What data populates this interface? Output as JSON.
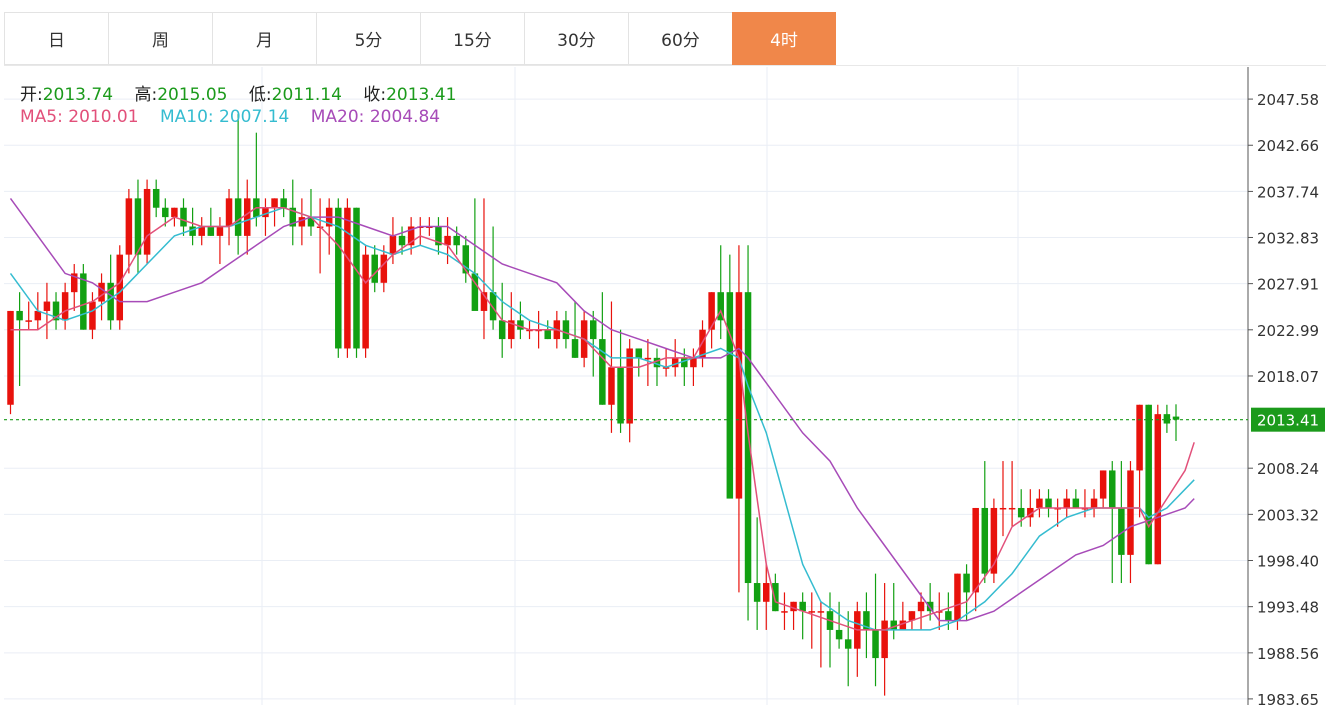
{
  "tabs": [
    {
      "label": "日",
      "active": false
    },
    {
      "label": "周",
      "active": false
    },
    {
      "label": "月",
      "active": false
    },
    {
      "label": "5分",
      "active": false
    },
    {
      "label": "15分",
      "active": false
    },
    {
      "label": "30分",
      "active": false
    },
    {
      "label": "60分",
      "active": false
    },
    {
      "label": "4时",
      "active": true
    }
  ],
  "ohlc": {
    "open_label": "开:",
    "open": "2013.74",
    "high_label": "高:",
    "high": "2015.05",
    "low_label": "低:",
    "low": "2011.14",
    "close_label": "收:",
    "close": "2013.41"
  },
  "ma": {
    "ma5_label": "MA5:",
    "ma5": "2010.01",
    "ma10_label": "MA10:",
    "ma10": "2007.14",
    "ma20_label": "MA20:",
    "ma20": "2004.84"
  },
  "colors": {
    "up": "#e8120c",
    "down": "#12a012",
    "ma5": "#e2507a",
    "ma10": "#35bcd0",
    "ma20": "#a74bb8",
    "current": "#1b9a1b",
    "accent": "#f0874a"
  },
  "chart_data": {
    "type": "candlestick",
    "ylim": [
      1983.0,
      2051.0
    ],
    "yticks": [
      "2047.58",
      "2042.66",
      "2037.74",
      "2032.83",
      "2027.91",
      "2022.99",
      "2018.07",
      "2013.41",
      "2008.24",
      "2003.32",
      "1998.40",
      "1993.48",
      "1988.56",
      "1983.65"
    ],
    "current_price": "2013.41",
    "candles": [
      [
        2015,
        2025,
        2014,
        2025
      ],
      [
        2025,
        2027,
        2017,
        2024
      ],
      [
        2024,
        2026,
        2023,
        2024
      ],
      [
        2024,
        2027,
        2023,
        2025
      ],
      [
        2025,
        2028,
        2022,
        2026
      ],
      [
        2026,
        2027,
        2023,
        2024
      ],
      [
        2024,
        2028,
        2023,
        2027
      ],
      [
        2027,
        2030,
        2025,
        2029
      ],
      [
        2029,
        2030,
        2023,
        2023
      ],
      [
        2023,
        2027,
        2022,
        2026
      ],
      [
        2026,
        2029,
        2024,
        2028
      ],
      [
        2028,
        2031,
        2023,
        2024
      ],
      [
        2024,
        2032,
        2023,
        2031
      ],
      [
        2031,
        2038,
        2029,
        2037
      ],
      [
        2037,
        2039,
        2029,
        2031
      ],
      [
        2031,
        2039,
        2030,
        2038
      ],
      [
        2038,
        2039,
        2035,
        2036
      ],
      [
        2036,
        2037,
        2034,
        2035
      ],
      [
        2035,
        2036,
        2034,
        2036
      ],
      [
        2036,
        2037,
        2033,
        2034
      ],
      [
        2034,
        2036,
        2032,
        2033
      ],
      [
        2033,
        2035,
        2032,
        2034
      ],
      [
        2034,
        2036,
        2033,
        2033
      ],
      [
        2033,
        2035,
        2030,
        2034
      ],
      [
        2034,
        2038,
        2032,
        2037
      ],
      [
        2037,
        2046,
        2031,
        2033
      ],
      [
        2033,
        2039,
        2031,
        2037
      ],
      [
        2037,
        2044,
        2034,
        2035
      ],
      [
        2035,
        2037,
        2033,
        2036
      ],
      [
        2036,
        2037,
        2034,
        2037
      ],
      [
        2037,
        2038,
        2035,
        2036
      ],
      [
        2036,
        2039,
        2032,
        2034
      ],
      [
        2034,
        2037,
        2032,
        2035
      ],
      [
        2035,
        2038,
        2033,
        2034
      ],
      [
        2034,
        2037,
        2029,
        2034
      ],
      [
        2034,
        2037,
        2031,
        2036
      ],
      [
        2036,
        2037,
        2020,
        2021
      ],
      [
        2021,
        2037,
        2020,
        2036
      ],
      [
        2036,
        2036,
        2020,
        2021
      ],
      [
        2021,
        2032,
        2020,
        2031
      ],
      [
        2031,
        2032,
        2027,
        2028
      ],
      [
        2028,
        2032,
        2027,
        2031
      ],
      [
        2031,
        2035,
        2030,
        2033
      ],
      [
        2033,
        2034,
        2031,
        2032
      ],
      [
        2032,
        2035,
        2031,
        2034
      ],
      [
        2034,
        2035,
        2032,
        2034
      ],
      [
        2034,
        2035,
        2033,
        2034
      ],
      [
        2034,
        2035,
        2031,
        2032
      ],
      [
        2032,
        2035,
        2030,
        2033
      ],
      [
        2033,
        2034,
        2031,
        2032
      ],
      [
        2032,
        2033,
        2028,
        2029
      ],
      [
        2029,
        2037,
        2027,
        2025
      ],
      [
        2025,
        2037,
        2022,
        2027
      ],
      [
        2027,
        2034,
        2023,
        2024
      ],
      [
        2024,
        2028,
        2020,
        2022
      ],
      [
        2022,
        2027,
        2021,
        2024
      ],
      [
        2024,
        2026,
        2022,
        2023
      ],
      [
        2023,
        2024,
        2022,
        2023
      ],
      [
        2023,
        2025,
        2021,
        2023
      ],
      [
        2023,
        2024,
        2022,
        2022
      ],
      [
        2022,
        2025,
        2021,
        2024
      ],
      [
        2024,
        2025,
        2021,
        2022
      ],
      [
        2022,
        2026,
        2020,
        2020
      ],
      [
        2020,
        2025,
        2019,
        2024
      ],
      [
        2024,
        2025,
        2018,
        2022
      ],
      [
        2022,
        2027,
        2015,
        2015
      ],
      [
        2015,
        2026,
        2012,
        2019
      ],
      [
        2019,
        2023,
        2012,
        2013
      ],
      [
        2013,
        2022,
        2011,
        2021
      ],
      [
        2021,
        2021,
        2018,
        2020
      ],
      [
        2020,
        2022,
        2017,
        2020
      ],
      [
        2020,
        2021,
        2017,
        2019
      ],
      [
        2019,
        2021,
        2018,
        2019
      ],
      [
        2019,
        2022,
        2018,
        2020
      ],
      [
        2020,
        2021,
        2017,
        2019
      ],
      [
        2019,
        2021,
        2017,
        2020
      ],
      [
        2020,
        2024,
        2019,
        2023
      ],
      [
        2023,
        2027,
        2021,
        2027
      ],
      [
        2027,
        2032,
        2022,
        2024
      ],
      [
        2027,
        2031,
        2015,
        2005
      ],
      [
        2005,
        2032,
        1995,
        2027
      ],
      [
        2027,
        2032,
        1992,
        1996
      ],
      [
        1996,
        2003,
        1991,
        1994
      ],
      [
        1994,
        1998,
        1991,
        1996
      ],
      [
        1996,
        1997,
        1993,
        1993
      ],
      [
        1993,
        1995,
        1991,
        1993
      ],
      [
        1993,
        1994,
        1991,
        1994
      ],
      [
        1994,
        1995,
        1990,
        1993
      ],
      [
        1993,
        1995,
        1989,
        1993
      ],
      [
        1993,
        1994,
        1987,
        1993
      ],
      [
        1993,
        1995,
        1987,
        1991
      ],
      [
        1991,
        1994,
        1989,
        1990
      ],
      [
        1990,
        1993,
        1985,
        1989
      ],
      [
        1989,
        1994,
        1986,
        1993
      ],
      [
        1993,
        1995,
        1988,
        1991
      ],
      [
        1991,
        1997,
        1985,
        1988
      ],
      [
        1988,
        1996,
        1984,
        1992
      ],
      [
        1992,
        1996,
        1990,
        1991
      ],
      [
        1991,
        1994,
        1991,
        1992
      ],
      [
        1992,
        1993,
        1991,
        1993
      ],
      [
        1993,
        1995,
        1991,
        1994
      ],
      [
        1994,
        1996,
        1992,
        1993
      ],
      [
        1993,
        1995,
        1991,
        1993
      ],
      [
        1993,
        1995,
        1991,
        1992
      ],
      [
        1992,
        1997,
        1991,
        1997
      ],
      [
        1997,
        1998,
        1992,
        1995
      ],
      [
        1995,
        2004,
        1993,
        2004
      ],
      [
        2004,
        2009,
        1996,
        1997
      ],
      [
        1997,
        2005,
        1996,
        2004
      ],
      [
        2004,
        2009,
        2001,
        2004
      ],
      [
        2004,
        2009,
        2002,
        2004
      ],
      [
        2004,
        2006,
        2002,
        2003
      ],
      [
        2003,
        2006,
        2002,
        2004
      ],
      [
        2004,
        2006,
        2003,
        2005
      ],
      [
        2005,
        2006,
        2003,
        2004
      ],
      [
        2004,
        2005,
        2002,
        2004
      ],
      [
        2004,
        2006,
        2003,
        2005
      ],
      [
        2005,
        2006,
        2004,
        2004
      ],
      [
        2004,
        2006,
        2003,
        2004
      ],
      [
        2004,
        2006,
        2003,
        2005
      ],
      [
        2005,
        2008,
        2004,
        2008
      ],
      [
        2008,
        2009,
        1996,
        2004
      ],
      [
        2004,
        2009,
        1996,
        1999
      ],
      [
        1999,
        2009,
        1996,
        2008
      ],
      [
        2008,
        2015,
        2003,
        2015
      ],
      [
        2015,
        2015,
        1998,
        1998
      ],
      [
        1998,
        2015,
        1998,
        2014
      ],
      [
        2014,
        2015,
        2012,
        2013
      ],
      [
        2013.74,
        2015.05,
        2011.14,
        2013.41
      ]
    ],
    "ma5": [
      [
        0,
        2023
      ],
      [
        3,
        2023
      ],
      [
        6,
        2025
      ],
      [
        9,
        2026
      ],
      [
        12,
        2028
      ],
      [
        15,
        2033
      ],
      [
        18,
        2035
      ],
      [
        21,
        2034
      ],
      [
        24,
        2034
      ],
      [
        27,
        2036
      ],
      [
        30,
        2036
      ],
      [
        33,
        2035
      ],
      [
        36,
        2032
      ],
      [
        39,
        2028
      ],
      [
        42,
        2031
      ],
      [
        45,
        2033
      ],
      [
        48,
        2032
      ],
      [
        51,
        2028
      ],
      [
        54,
        2024
      ],
      [
        57,
        2023
      ],
      [
        60,
        2023
      ],
      [
        63,
        2022
      ],
      [
        66,
        2019
      ],
      [
        69,
        2019
      ],
      [
        72,
        2020
      ],
      [
        75,
        2020
      ],
      [
        78,
        2025
      ],
      [
        80,
        2020
      ],
      [
        81,
        2012
      ],
      [
        82,
        2005
      ],
      [
        83,
        1998
      ],
      [
        84,
        1994
      ],
      [
        87,
        1993
      ],
      [
        90,
        1992
      ],
      [
        93,
        1991
      ],
      [
        96,
        1991
      ],
      [
        99,
        1992
      ],
      [
        102,
        1993
      ],
      [
        105,
        1994
      ],
      [
        108,
        1998
      ],
      [
        110,
        2002
      ],
      [
        113,
        2004
      ],
      [
        116,
        2004
      ],
      [
        119,
        2004
      ],
      [
        122,
        2004
      ],
      [
        124,
        2004
      ],
      [
        125,
        2002
      ],
      [
        127,
        2005
      ],
      [
        129,
        2008
      ],
      [
        130,
        2011
      ]
    ],
    "ma10": [
      [
        0,
        2029
      ],
      [
        3,
        2025
      ],
      [
        6,
        2024
      ],
      [
        9,
        2025
      ],
      [
        12,
        2027
      ],
      [
        15,
        2030
      ],
      [
        18,
        2033
      ],
      [
        21,
        2034
      ],
      [
        24,
        2034
      ],
      [
        27,
        2035
      ],
      [
        30,
        2036
      ],
      [
        33,
        2035
      ],
      [
        36,
        2034
      ],
      [
        39,
        2032
      ],
      [
        42,
        2031
      ],
      [
        45,
        2032
      ],
      [
        48,
        2031
      ],
      [
        51,
        2029
      ],
      [
        54,
        2026
      ],
      [
        57,
        2024
      ],
      [
        60,
        2023
      ],
      [
        63,
        2022
      ],
      [
        66,
        2020
      ],
      [
        69,
        2020
      ],
      [
        72,
        2019
      ],
      [
        75,
        2020
      ],
      [
        78,
        2021
      ],
      [
        80,
        2020
      ],
      [
        81,
        2017
      ],
      [
        83,
        2012
      ],
      [
        85,
        2005
      ],
      [
        87,
        1998
      ],
      [
        89,
        1994
      ],
      [
        92,
        1992
      ],
      [
        95,
        1991
      ],
      [
        98,
        1991
      ],
      [
        101,
        1991
      ],
      [
        104,
        1992
      ],
      [
        107,
        1994
      ],
      [
        110,
        1997
      ],
      [
        113,
        2001
      ],
      [
        116,
        2003
      ],
      [
        119,
        2004
      ],
      [
        122,
        2004
      ],
      [
        124,
        2004
      ],
      [
        125,
        2003
      ],
      [
        127,
        2004
      ],
      [
        130,
        2007
      ]
    ],
    "ma20": [
      [
        0,
        2037
      ],
      [
        3,
        2033
      ],
      [
        6,
        2029
      ],
      [
        9,
        2028
      ],
      [
        12,
        2026
      ],
      [
        15,
        2026
      ],
      [
        18,
        2027
      ],
      [
        21,
        2028
      ],
      [
        24,
        2030
      ],
      [
        27,
        2032
      ],
      [
        30,
        2034
      ],
      [
        33,
        2035
      ],
      [
        36,
        2035
      ],
      [
        39,
        2034
      ],
      [
        42,
        2033
      ],
      [
        45,
        2034
      ],
      [
        48,
        2034
      ],
      [
        51,
        2032
      ],
      [
        54,
        2030
      ],
      [
        57,
        2029
      ],
      [
        60,
        2028
      ],
      [
        63,
        2025
      ],
      [
        66,
        2023
      ],
      [
        69,
        2022
      ],
      [
        72,
        2021
      ],
      [
        75,
        2020
      ],
      [
        78,
        2020
      ],
      [
        80,
        2021
      ],
      [
        81,
        2020
      ],
      [
        84,
        2016
      ],
      [
        87,
        2012
      ],
      [
        90,
        2009
      ],
      [
        93,
        2004
      ],
      [
        96,
        2000
      ],
      [
        99,
        1996
      ],
      [
        102,
        1992
      ],
      [
        105,
        1992
      ],
      [
        108,
        1993
      ],
      [
        111,
        1995
      ],
      [
        114,
        1997
      ],
      [
        117,
        1999
      ],
      [
        120,
        2000
      ],
      [
        123,
        2002
      ],
      [
        126,
        2003
      ],
      [
        129,
        2004
      ],
      [
        130,
        2005
      ]
    ]
  }
}
